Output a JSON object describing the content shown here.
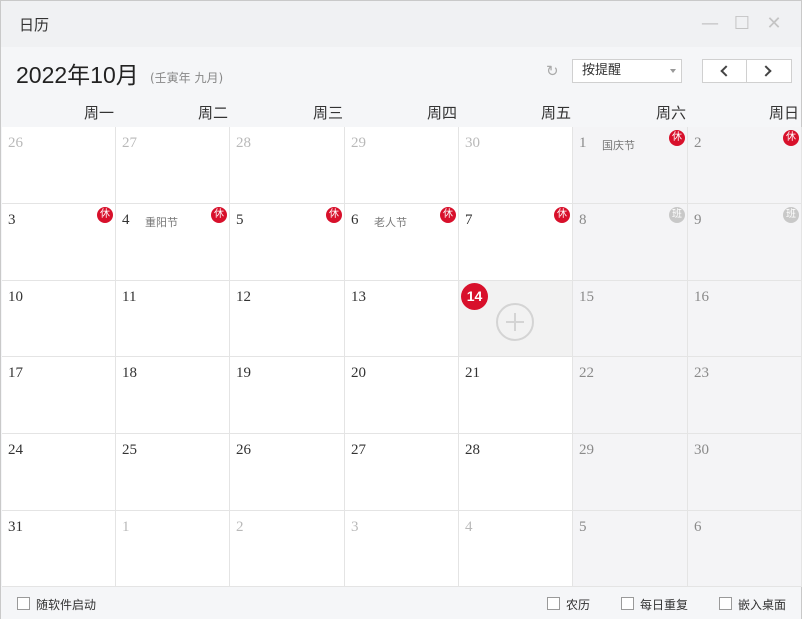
{
  "window": {
    "title": "日历",
    "controls": {
      "minimize": "—",
      "maximize": "☐",
      "close": "✕"
    }
  },
  "header": {
    "month_title": "2022年10月",
    "lunar_subtitle": "(壬寅年 九月)",
    "reminder_select": "按提醒",
    "refresh_icon": "↻"
  },
  "weekdays": [
    "周一",
    "周二",
    "周三",
    "周四",
    "周五",
    "周六",
    "周日"
  ],
  "badge_text": {
    "rest": "休",
    "work": "班"
  },
  "today": 14,
  "weeks": [
    [
      {
        "day": "26",
        "other": true
      },
      {
        "day": "27",
        "other": true
      },
      {
        "day": "28",
        "other": true
      },
      {
        "day": "29",
        "other": true
      },
      {
        "day": "30",
        "other": true
      },
      {
        "day": "1",
        "festival": "国庆节",
        "badge": "rest"
      },
      {
        "day": "2",
        "badge": "rest"
      }
    ],
    [
      {
        "day": "3",
        "badge": "rest"
      },
      {
        "day": "4",
        "festival": "重阳节",
        "badge": "rest"
      },
      {
        "day": "5",
        "badge": "rest"
      },
      {
        "day": "6",
        "festival": "老人节",
        "badge": "rest"
      },
      {
        "day": "7",
        "badge": "rest"
      },
      {
        "day": "8",
        "badge": "work"
      },
      {
        "day": "9",
        "badge": "work"
      }
    ],
    [
      {
        "day": "10"
      },
      {
        "day": "11"
      },
      {
        "day": "12"
      },
      {
        "day": "13"
      },
      {
        "day": "14",
        "today": true
      },
      {
        "day": "15"
      },
      {
        "day": "16"
      }
    ],
    [
      {
        "day": "17"
      },
      {
        "day": "18"
      },
      {
        "day": "19"
      },
      {
        "day": "20"
      },
      {
        "day": "21"
      },
      {
        "day": "22"
      },
      {
        "day": "23"
      }
    ],
    [
      {
        "day": "24"
      },
      {
        "day": "25"
      },
      {
        "day": "26"
      },
      {
        "day": "27"
      },
      {
        "day": "28"
      },
      {
        "day": "29"
      },
      {
        "day": "30"
      }
    ],
    [
      {
        "day": "31"
      },
      {
        "day": "1",
        "other": true
      },
      {
        "day": "2",
        "other": true
      },
      {
        "day": "3",
        "other": true
      },
      {
        "day": "4",
        "other": true
      },
      {
        "day": "5",
        "other": true
      },
      {
        "day": "6",
        "other": true
      }
    ]
  ],
  "footer": {
    "autostart": "随软件启动",
    "lunar": "农历",
    "daily_repeat": "每日重复",
    "embed_desktop": "嵌入桌面"
  }
}
